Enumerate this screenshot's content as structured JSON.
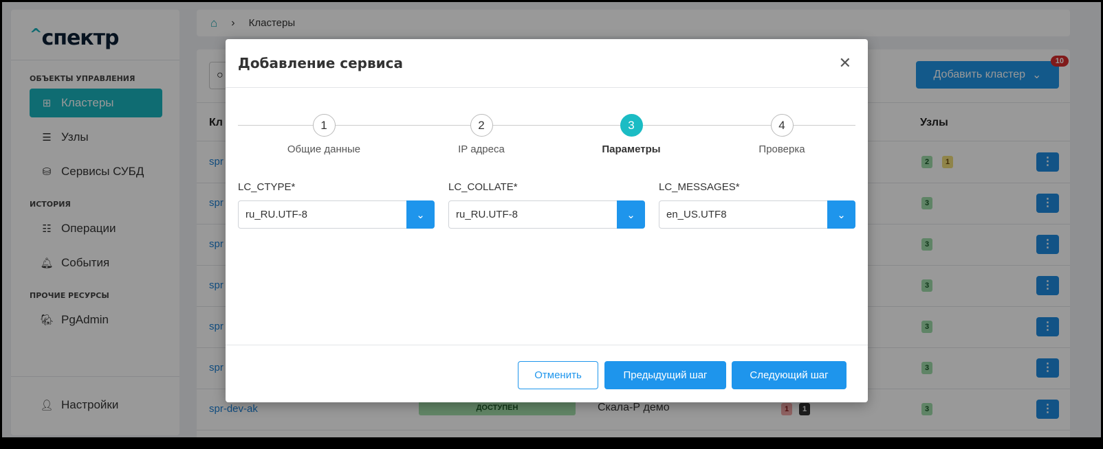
{
  "logo": "спектр",
  "sidebar": {
    "sections": [
      "ОБЪЕКТЫ УПРАВЛЕНИЯ",
      "ИСТОРИЯ",
      "ПРОЧИЕ РЕСУРСЫ"
    ],
    "items": [
      {
        "label": "Кластеры"
      },
      {
        "label": "Узлы"
      },
      {
        "label": "Сервисы СУБД"
      },
      {
        "label": "Операции"
      },
      {
        "label": "События"
      },
      {
        "label": "PgAdmin"
      }
    ],
    "settings": "Настройки"
  },
  "breadcrumb": {
    "current": "Кластеры"
  },
  "toolbar": {
    "add_cluster": "Добавить кластер",
    "notification_count": "10"
  },
  "table": {
    "headers": {
      "cluster": "Кл",
      "nodes": "Узлы"
    },
    "rows": [
      {
        "name": "spr",
        "nodes": [
          "2",
          "1"
        ]
      },
      {
        "name": "spr",
        "nodes": [
          "3"
        ]
      },
      {
        "name": "spr",
        "nodes": [
          "3"
        ]
      },
      {
        "name": "spr",
        "nodes": [
          "3"
        ]
      },
      {
        "name": "spr",
        "nodes": [
          "3"
        ]
      },
      {
        "name": "spr",
        "nodes": [
          "3"
        ]
      },
      {
        "name": "spr-dev-ak",
        "status": "ДОСТУПЕН",
        "type": "Скала-Р демо",
        "services": [
          "1",
          "1"
        ],
        "nodes": [
          "3"
        ]
      }
    ]
  },
  "modal": {
    "title": "Добавление сервиса",
    "steps": [
      {
        "num": "1",
        "label": "Общие данные"
      },
      {
        "num": "2",
        "label": "IP адреса"
      },
      {
        "num": "3",
        "label": "Параметры"
      },
      {
        "num": "4",
        "label": "Проверка"
      }
    ],
    "current_step": 3,
    "fields": [
      {
        "label": "LC_CTYPE*",
        "value": "ru_RU.UTF-8"
      },
      {
        "label": "LC_COLLATE*",
        "value": "ru_RU.UTF-8"
      },
      {
        "label": "LC_MESSAGES*",
        "value": "en_US.UTF8"
      }
    ],
    "buttons": {
      "cancel": "Отменить",
      "prev": "Предыдущий шаг",
      "next": "Следующий шаг"
    }
  }
}
